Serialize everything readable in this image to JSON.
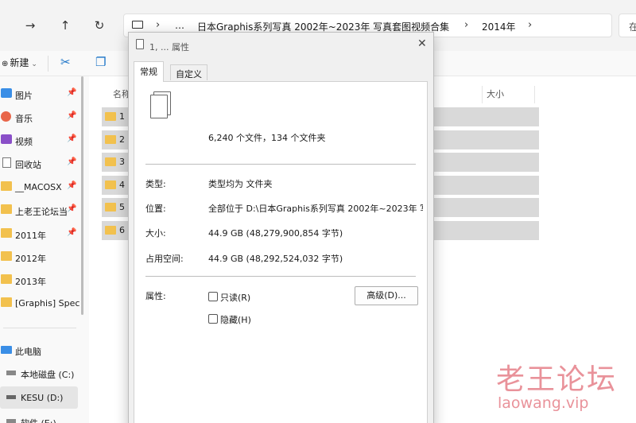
{
  "address_bar": {
    "back_icon": "arrow-right-icon",
    "up_icon": "arrow-up-icon",
    "refresh_icon": "refresh-icon",
    "breadcrumb": [
      "…",
      "日本Graphis系列写真 2002年~2023年 写真套图视频合集",
      "2014年"
    ],
    "search_placeholder": "在"
  },
  "toolbar": {
    "new_label": "新建",
    "cut_icon": "scissors-icon",
    "copy_icon": "copy-icon"
  },
  "sidebar": {
    "items": [
      {
        "label": "图片",
        "icon": "pictures-icon",
        "pinned": true
      },
      {
        "label": "音乐",
        "icon": "music-icon",
        "pinned": true
      },
      {
        "label": "视频",
        "icon": "video-icon",
        "pinned": true
      },
      {
        "label": "回收站",
        "icon": "recycle-bin-icon",
        "pinned": true
      },
      {
        "label": "__MACOSX",
        "icon": "folder-icon",
        "pinned": true
      },
      {
        "label": "上老王论坛当",
        "icon": "folder-icon",
        "pinned": true
      },
      {
        "label": "2011年",
        "icon": "folder-icon",
        "pinned": true
      },
      {
        "label": "2012年",
        "icon": "folder-icon",
        "pinned": false
      },
      {
        "label": "2013年",
        "icon": "folder-icon",
        "pinned": false
      },
      {
        "label": "[Graphis] Spec",
        "icon": "folder-icon",
        "pinned": false
      }
    ],
    "drives": [
      {
        "label": "此电脑",
        "icon": "this-pc-icon"
      },
      {
        "label": "本地磁盘 (C:)",
        "icon": "drive-c-icon"
      },
      {
        "label": "KESU (D:)",
        "icon": "drive-d-icon"
      },
      {
        "label": "软件 (E:)",
        "icon": "drive-e-icon"
      }
    ]
  },
  "content": {
    "columns": {
      "name": "名称",
      "size": "大小"
    },
    "rows": [
      "1",
      "2",
      "3",
      "4",
      "5",
      "6"
    ]
  },
  "dialog": {
    "title": "1, ... 属性",
    "tabs": [
      "常规",
      "自定义"
    ],
    "active_tab": "常规",
    "summary": "6,240 个文件，134 个文件夹",
    "fields": {
      "type_label": "类型:",
      "type_value": "类型均为 文件夹",
      "location_label": "位置:",
      "location_value": "全部位于 D:\\日本Graphis系列写真 2002年~2023年 写",
      "size_label": "大小:",
      "size_value": "44.9 GB (48,279,900,854 字节)",
      "disk_label": "占用空间:",
      "disk_value": "44.9 GB (48,292,524,032 字节)",
      "attr_label": "属性:",
      "readonly_label": "只读(R)",
      "hidden_label": "隐藏(H)",
      "advanced_label": "高级(D)..."
    }
  },
  "watermark": {
    "cn": "老王论坛",
    "en": "laowang.vip"
  }
}
